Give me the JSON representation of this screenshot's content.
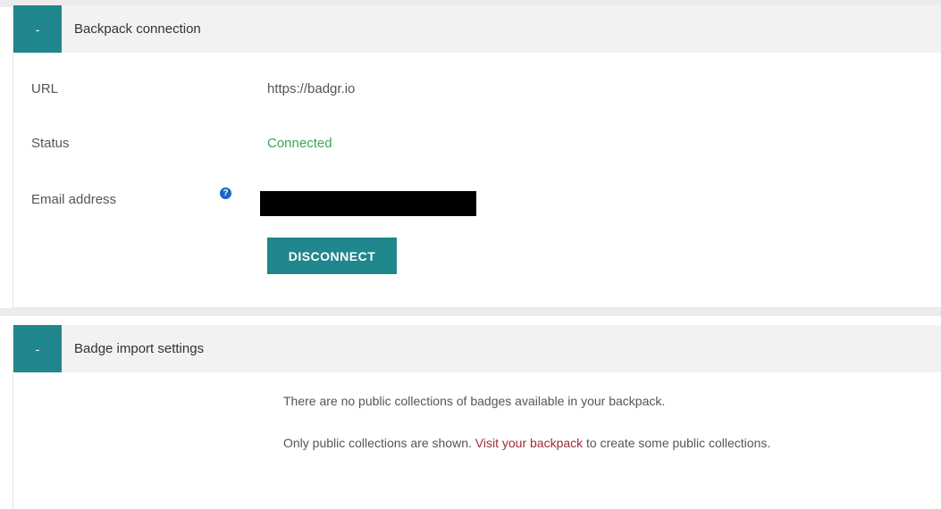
{
  "backpack": {
    "toggle_label": "-",
    "title": "Backpack connection",
    "url_label": "URL",
    "url_value": "https://badgr.io",
    "status_label": "Status",
    "status_value": "Connected",
    "email_label": "Email address",
    "help_icon": "question-circle",
    "disconnect_label": "DISCONNECT"
  },
  "badge_import": {
    "toggle_label": "-",
    "title": "Badge import settings",
    "no_collections_text": "There are no public collections of badges available in your backpack.",
    "only_public_text": "Only public collections are shown.",
    "visit_link_text": "Visit your backpack",
    "after_link_text": " to create some public collections."
  },
  "colors": {
    "accent": "#1f878d",
    "status_connected": "#3aa84f",
    "link": "#9b2c3a",
    "help_icon": "#1a66c7"
  }
}
